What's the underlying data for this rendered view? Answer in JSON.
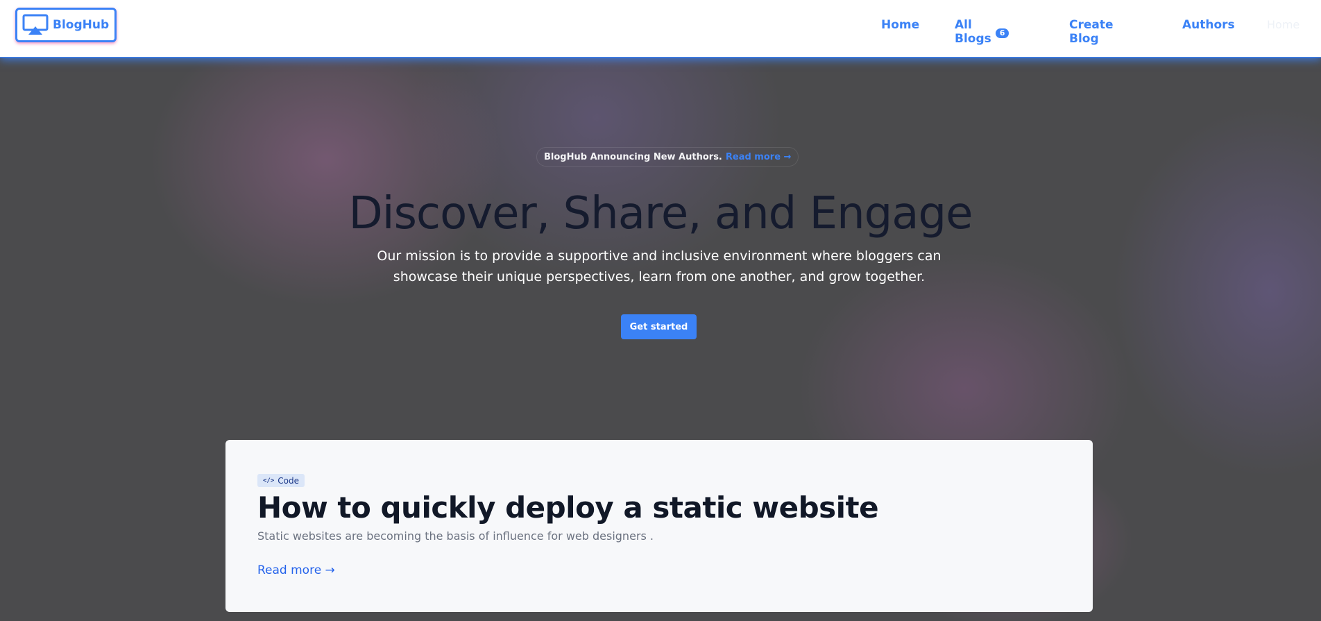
{
  "brand": {
    "name": "BlogHub",
    "logo_icon": "screen-cast-icon",
    "accent_color": "#3b82f6"
  },
  "nav": {
    "home": "Home",
    "all_blogs": "All Blogs",
    "all_blogs_count": "6",
    "create_blog": "Create Blog",
    "authors": "Authors",
    "ghost_home": "Home"
  },
  "hero": {
    "announcement": "BlogHub Announcing New Authors.",
    "announcement_link": "Read more →",
    "title": "Discover, Share, and Engage",
    "subtitle_line1": "Our mission is to provide a supportive and inclusive environment where bloggers can",
    "subtitle_line2": "showcase their unique perspectives, learn from one another, and grow together.",
    "cta": "Get started"
  },
  "featured_post": {
    "tag_icon": "code-icon",
    "tag": "Code",
    "title": "How to quickly deploy a static website",
    "description": "Static websites are becoming the basis of influence for web designers .",
    "read_more": "Read more →"
  }
}
